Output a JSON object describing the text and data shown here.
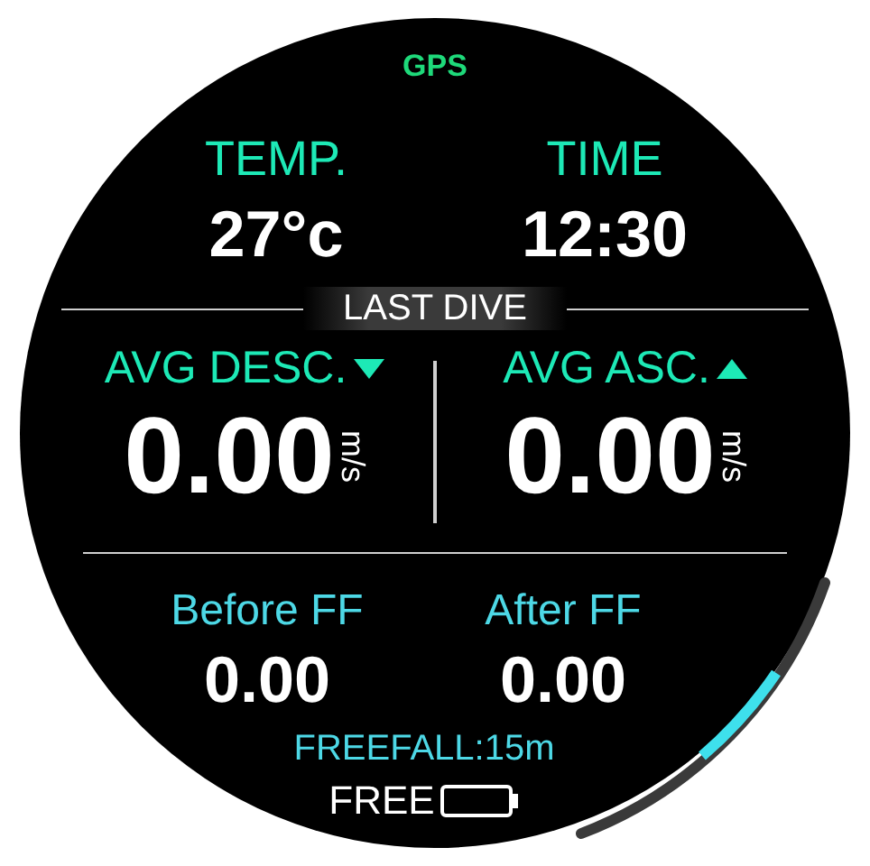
{
  "gps": "GPS",
  "top_stats": [
    {
      "label": "TEMP.",
      "value": "27°c"
    },
    {
      "label": "TIME",
      "value": "12:30"
    }
  ],
  "section_title": "LAST DIVE",
  "speeds": [
    {
      "label": "AVG DESC.",
      "value": "0.00",
      "unit": "m/s"
    },
    {
      "label": "AVG ASC.",
      "value": "0.00",
      "unit": "m/s"
    }
  ],
  "freefall_stats": [
    {
      "label": "Before FF",
      "value": "0.00"
    },
    {
      "label": "After FF",
      "value": "0.00"
    }
  ],
  "freefall_depth": "FREEFALL:15m",
  "mode": "FREE"
}
